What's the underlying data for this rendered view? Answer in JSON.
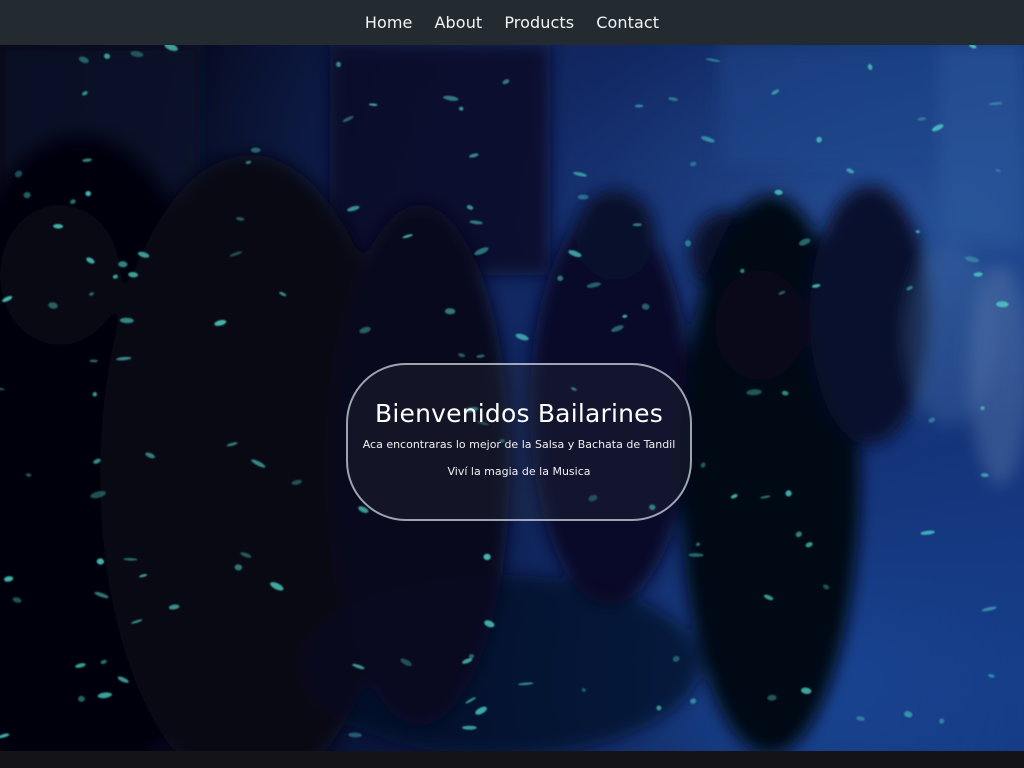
{
  "nav": {
    "links": [
      {
        "label": "Home"
      },
      {
        "label": "About"
      },
      {
        "label": "Products"
      },
      {
        "label": "Contact"
      }
    ]
  },
  "hero": {
    "title": "Bienvenidos Bailarines",
    "subtitle": "Aca encontraras lo mejor de la Salsa y Bachata de Tandil",
    "tagline": "Viví la magia de la Musica"
  },
  "colors": {
    "navbar_bg": "#232b31",
    "nav_text": "#f2f4f5",
    "hero_accent": "#1d4aa0",
    "light_spot": "#4fd6c8"
  }
}
